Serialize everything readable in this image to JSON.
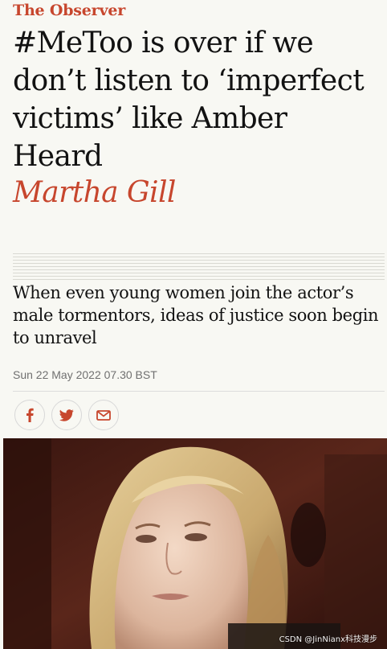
{
  "article": {
    "kicker": "The Observer",
    "headline": "#MeToo is over if we don’t listen to ‘imperfect victims’ like Amber Heard",
    "byline": "Martha Gill",
    "standfirst": "When even young women join the actor’s male tormentors, ideas of justice soon begin to unravel",
    "dateline": "Sun 22 May 2022 07.30 BST"
  },
  "share": [
    {
      "icon": "facebook-icon"
    },
    {
      "icon": "twitter-icon"
    },
    {
      "icon": "email-icon"
    }
  ],
  "photo": {
    "watermark": "CSDN @JinNianx科技漫步"
  },
  "colors": {
    "accent": "#c7462d",
    "text": "#121212",
    "muted": "#707070",
    "background": "#f8f8f3"
  }
}
